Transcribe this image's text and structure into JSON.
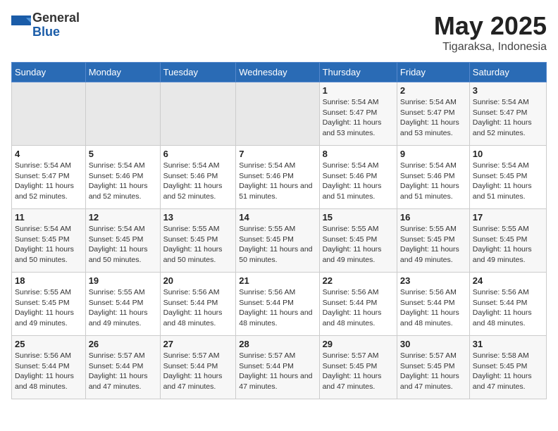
{
  "logo": {
    "general": "General",
    "blue": "Blue"
  },
  "header": {
    "title": "May 2025",
    "subtitle": "Tigaraksa, Indonesia"
  },
  "days_of_week": [
    "Sunday",
    "Monday",
    "Tuesday",
    "Wednesday",
    "Thursday",
    "Friday",
    "Saturday"
  ],
  "weeks": [
    [
      {
        "day": null
      },
      {
        "day": null
      },
      {
        "day": null
      },
      {
        "day": null
      },
      {
        "day": 1,
        "sunrise": "Sunrise: 5:54 AM",
        "sunset": "Sunset: 5:47 PM",
        "daylight": "Daylight: 11 hours and 53 minutes."
      },
      {
        "day": 2,
        "sunrise": "Sunrise: 5:54 AM",
        "sunset": "Sunset: 5:47 PM",
        "daylight": "Daylight: 11 hours and 53 minutes."
      },
      {
        "day": 3,
        "sunrise": "Sunrise: 5:54 AM",
        "sunset": "Sunset: 5:47 PM",
        "daylight": "Daylight: 11 hours and 52 minutes."
      }
    ],
    [
      {
        "day": 4,
        "sunrise": "Sunrise: 5:54 AM",
        "sunset": "Sunset: 5:47 PM",
        "daylight": "Daylight: 11 hours and 52 minutes."
      },
      {
        "day": 5,
        "sunrise": "Sunrise: 5:54 AM",
        "sunset": "Sunset: 5:46 PM",
        "daylight": "Daylight: 11 hours and 52 minutes."
      },
      {
        "day": 6,
        "sunrise": "Sunrise: 5:54 AM",
        "sunset": "Sunset: 5:46 PM",
        "daylight": "Daylight: 11 hours and 52 minutes."
      },
      {
        "day": 7,
        "sunrise": "Sunrise: 5:54 AM",
        "sunset": "Sunset: 5:46 PM",
        "daylight": "Daylight: 11 hours and 51 minutes."
      },
      {
        "day": 8,
        "sunrise": "Sunrise: 5:54 AM",
        "sunset": "Sunset: 5:46 PM",
        "daylight": "Daylight: 11 hours and 51 minutes."
      },
      {
        "day": 9,
        "sunrise": "Sunrise: 5:54 AM",
        "sunset": "Sunset: 5:46 PM",
        "daylight": "Daylight: 11 hours and 51 minutes."
      },
      {
        "day": 10,
        "sunrise": "Sunrise: 5:54 AM",
        "sunset": "Sunset: 5:45 PM",
        "daylight": "Daylight: 11 hours and 51 minutes."
      }
    ],
    [
      {
        "day": 11,
        "sunrise": "Sunrise: 5:54 AM",
        "sunset": "Sunset: 5:45 PM",
        "daylight": "Daylight: 11 hours and 50 minutes."
      },
      {
        "day": 12,
        "sunrise": "Sunrise: 5:54 AM",
        "sunset": "Sunset: 5:45 PM",
        "daylight": "Daylight: 11 hours and 50 minutes."
      },
      {
        "day": 13,
        "sunrise": "Sunrise: 5:55 AM",
        "sunset": "Sunset: 5:45 PM",
        "daylight": "Daylight: 11 hours and 50 minutes."
      },
      {
        "day": 14,
        "sunrise": "Sunrise: 5:55 AM",
        "sunset": "Sunset: 5:45 PM",
        "daylight": "Daylight: 11 hours and 50 minutes."
      },
      {
        "day": 15,
        "sunrise": "Sunrise: 5:55 AM",
        "sunset": "Sunset: 5:45 PM",
        "daylight": "Daylight: 11 hours and 49 minutes."
      },
      {
        "day": 16,
        "sunrise": "Sunrise: 5:55 AM",
        "sunset": "Sunset: 5:45 PM",
        "daylight": "Daylight: 11 hours and 49 minutes."
      },
      {
        "day": 17,
        "sunrise": "Sunrise: 5:55 AM",
        "sunset": "Sunset: 5:45 PM",
        "daylight": "Daylight: 11 hours and 49 minutes."
      }
    ],
    [
      {
        "day": 18,
        "sunrise": "Sunrise: 5:55 AM",
        "sunset": "Sunset: 5:45 PM",
        "daylight": "Daylight: 11 hours and 49 minutes."
      },
      {
        "day": 19,
        "sunrise": "Sunrise: 5:55 AM",
        "sunset": "Sunset: 5:44 PM",
        "daylight": "Daylight: 11 hours and 49 minutes."
      },
      {
        "day": 20,
        "sunrise": "Sunrise: 5:56 AM",
        "sunset": "Sunset: 5:44 PM",
        "daylight": "Daylight: 11 hours and 48 minutes."
      },
      {
        "day": 21,
        "sunrise": "Sunrise: 5:56 AM",
        "sunset": "Sunset: 5:44 PM",
        "daylight": "Daylight: 11 hours and 48 minutes."
      },
      {
        "day": 22,
        "sunrise": "Sunrise: 5:56 AM",
        "sunset": "Sunset: 5:44 PM",
        "daylight": "Daylight: 11 hours and 48 minutes."
      },
      {
        "day": 23,
        "sunrise": "Sunrise: 5:56 AM",
        "sunset": "Sunset: 5:44 PM",
        "daylight": "Daylight: 11 hours and 48 minutes."
      },
      {
        "day": 24,
        "sunrise": "Sunrise: 5:56 AM",
        "sunset": "Sunset: 5:44 PM",
        "daylight": "Daylight: 11 hours and 48 minutes."
      }
    ],
    [
      {
        "day": 25,
        "sunrise": "Sunrise: 5:56 AM",
        "sunset": "Sunset: 5:44 PM",
        "daylight": "Daylight: 11 hours and 48 minutes."
      },
      {
        "day": 26,
        "sunrise": "Sunrise: 5:57 AM",
        "sunset": "Sunset: 5:44 PM",
        "daylight": "Daylight: 11 hours and 47 minutes."
      },
      {
        "day": 27,
        "sunrise": "Sunrise: 5:57 AM",
        "sunset": "Sunset: 5:44 PM",
        "daylight": "Daylight: 11 hours and 47 minutes."
      },
      {
        "day": 28,
        "sunrise": "Sunrise: 5:57 AM",
        "sunset": "Sunset: 5:44 PM",
        "daylight": "Daylight: 11 hours and 47 minutes."
      },
      {
        "day": 29,
        "sunrise": "Sunrise: 5:57 AM",
        "sunset": "Sunset: 5:45 PM",
        "daylight": "Daylight: 11 hours and 47 minutes."
      },
      {
        "day": 30,
        "sunrise": "Sunrise: 5:57 AM",
        "sunset": "Sunset: 5:45 PM",
        "daylight": "Daylight: 11 hours and 47 minutes."
      },
      {
        "day": 31,
        "sunrise": "Sunrise: 5:58 AM",
        "sunset": "Sunset: 5:45 PM",
        "daylight": "Daylight: 11 hours and 47 minutes."
      }
    ]
  ]
}
